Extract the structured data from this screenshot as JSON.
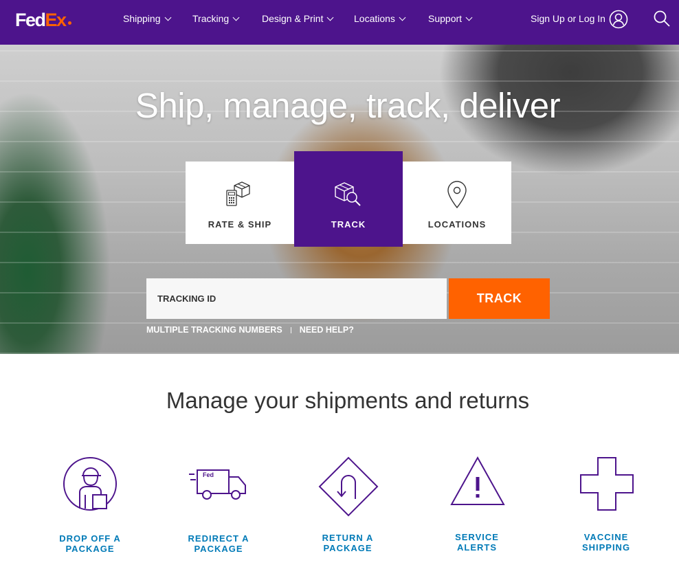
{
  "brand": {
    "logo_left": "Fed",
    "logo_right": "Ex"
  },
  "nav": {
    "items": [
      {
        "label": "Shipping"
      },
      {
        "label": "Tracking"
      },
      {
        "label": "Design & Print"
      },
      {
        "label": "Locations"
      },
      {
        "label": "Support"
      }
    ],
    "signin_label": "Sign Up or Log In"
  },
  "hero": {
    "title": "Ship, manage, track, deliver",
    "tabs": [
      {
        "label": "RATE & SHIP",
        "icon": "rate-ship-icon"
      },
      {
        "label": "TRACK",
        "icon": "track-package-icon",
        "active": true
      },
      {
        "label": "LOCATIONS",
        "icon": "location-pin-icon"
      }
    ],
    "tracking": {
      "placeholder": "TRACKING ID",
      "button_label": "TRACK",
      "links": [
        "MULTIPLE TRACKING NUMBERS",
        "NEED HELP?"
      ]
    }
  },
  "manage": {
    "title": "Manage your shipments and returns",
    "items": [
      {
        "label": "DROP OFF A\nPACKAGE",
        "icon": "courier-icon"
      },
      {
        "label": "REDIRECT A\nPACKAGE",
        "icon": "delivery-truck-icon"
      },
      {
        "label": "RETURN A\nPACKAGE",
        "icon": "u-turn-sign-icon"
      },
      {
        "label": "SERVICE\nALERTS",
        "icon": "warning-triangle-icon"
      },
      {
        "label": "VACCINE\nSHIPPING",
        "icon": "medical-cross-icon"
      }
    ]
  },
  "colors": {
    "purple": "#4d148c",
    "orange": "#ff6200",
    "link_blue": "#007ab7"
  }
}
